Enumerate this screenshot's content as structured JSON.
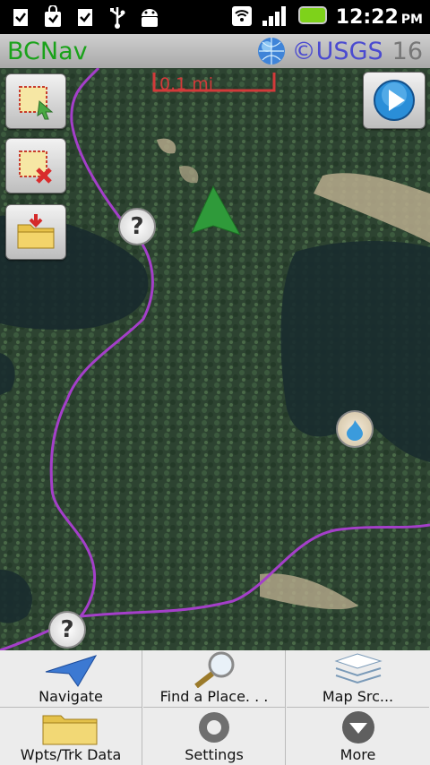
{
  "status_bar": {
    "time": "12:22",
    "ampm": "PM",
    "icons": [
      "clipboard-icon",
      "shopping-bag-icon",
      "clipboard-icon",
      "usb-icon",
      "android-icon",
      "wifi-icon",
      "signal-icon",
      "battery-icon"
    ]
  },
  "title_bar": {
    "app_name": "BCNav",
    "map_source": "©USGS",
    "zoom_level": "16"
  },
  "map": {
    "scale_label": "0.1 mi",
    "marker_glyph": "?"
  },
  "menu": {
    "items": [
      {
        "label": "Navigate",
        "icon": "navigate-arrow-icon"
      },
      {
        "label": "Find a Place. . .",
        "icon": "magnifier-icon"
      },
      {
        "label": "Map Src...",
        "icon": "map-layers-icon"
      },
      {
        "label": "Wpts/Trk Data",
        "icon": "folder-icon"
      },
      {
        "label": "Settings",
        "icon": "gear-icon"
      },
      {
        "label": "More",
        "icon": "more-icon"
      }
    ]
  }
}
